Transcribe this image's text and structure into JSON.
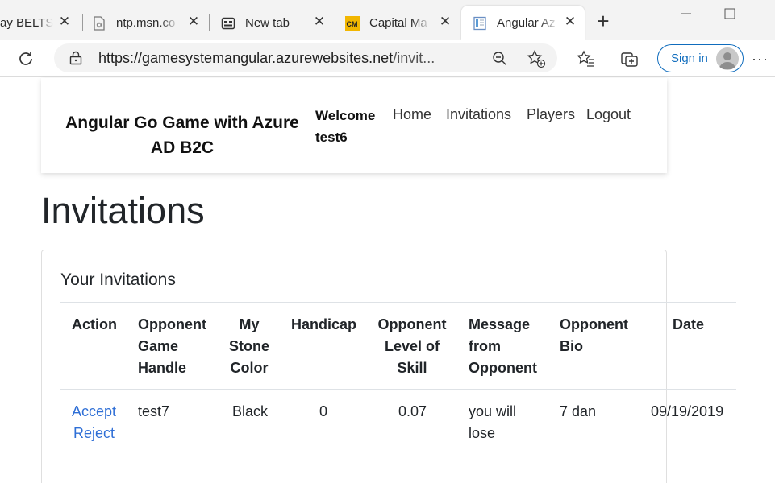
{
  "browser": {
    "tabs": [
      {
        "label": "ay BELTSS",
        "icon": "pdf-doc-icon"
      },
      {
        "label": "ntp.msn.co",
        "icon": "blocked-page-icon"
      },
      {
        "label": "New tab",
        "icon": "new-tab-page-icon"
      },
      {
        "label": "Capital Ma",
        "icon": "capital-markets-logo-icon"
      },
      {
        "label": "Angular Az",
        "icon": "page-icon",
        "active": true
      }
    ],
    "url": {
      "host": "https://gamesystemangular.azurewebsites.net",
      "rest": "/invit..."
    },
    "signin_label": "Sign in",
    "accent_color": "#0f6cbd"
  },
  "site": {
    "brand": "Angular Go Game with Azure AD B2C",
    "welcome_label": "Welcome",
    "username": "test6",
    "nav": [
      "Home",
      "Invitations",
      "Players",
      "Logout"
    ]
  },
  "page": {
    "title": "Invitations",
    "card_title": "Your Invitations"
  },
  "table": {
    "headers": [
      "Action",
      "Opponent Game Handle",
      "My Stone Color",
      "Handicap",
      "Opponent Level of Skill",
      "Message from Opponent",
      "Opponent Bio",
      "Date"
    ],
    "rows": [
      {
        "actions": [
          "Accept",
          "Reject"
        ],
        "handle": "test7",
        "stone_color": "Black",
        "handicap": "0",
        "skill": "0.07",
        "message": "you will lose",
        "bio": "7 dan",
        "date": "09/19/2019"
      }
    ],
    "link_color": "#2f6fd6"
  }
}
